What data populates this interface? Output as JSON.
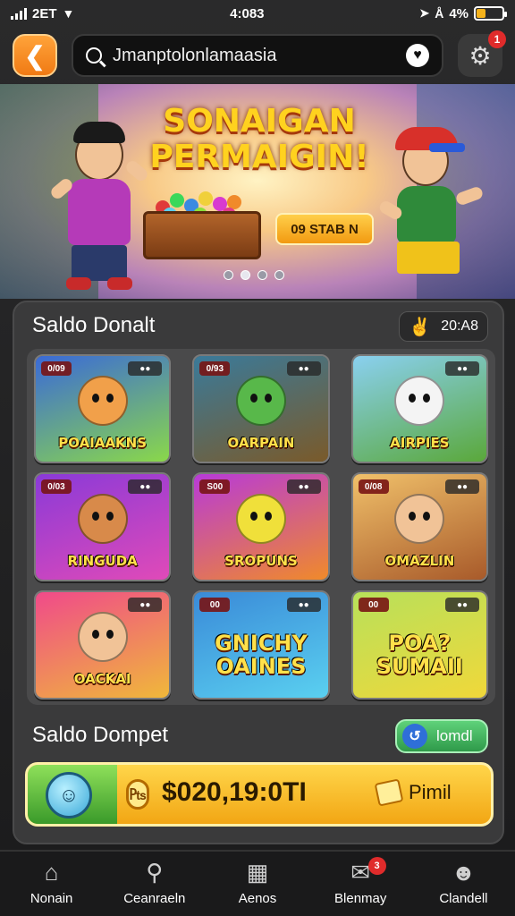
{
  "status_bar": {
    "carrier": "2ET",
    "time": "4:083",
    "battery_text": "4%",
    "battery_level": 0.35
  },
  "header": {
    "back_icon": "chevron-left-icon",
    "search_text": "Jmanptolonlamaasia",
    "notification_count": "1"
  },
  "banner": {
    "title": "SONAIGAN PERMAIGIN!",
    "cta_label": "09 STAB N",
    "slides_total": 4,
    "active_slide": 1
  },
  "games_section": {
    "title": "Saldo Donalt",
    "balance": "20:A8",
    "games": [
      {
        "title": "POAIAAKNS",
        "tag": "0/09",
        "tag2": "",
        "color1": "#3a6ad8",
        "color2": "#8ad84a",
        "mascot": "#f1a04a"
      },
      {
        "title": "OARPAIN",
        "tag": "0/93",
        "tag2": "",
        "color1": "#3a7a9a",
        "color2": "#7a5a2a",
        "mascot": "#58b84a"
      },
      {
        "title": "AIRPIES",
        "tag": "",
        "tag2": "",
        "color1": "#8ad0f0",
        "color2": "#5aa83a",
        "mascot": "#f4f4f4"
      },
      {
        "title": "RINGUDA",
        "tag": "0/03",
        "tag2": "",
        "color1": "#8a3ad8",
        "color2": "#e04ab8",
        "mascot": "#d88a4a"
      },
      {
        "title": "SROPUNS",
        "tag": "S00",
        "tag2": "",
        "color1": "#b83ad8",
        "color2": "#f08a2a",
        "mascot": "#f0e03a"
      },
      {
        "title": "OMAZLIN",
        "tag": "0/08",
        "tag2": "",
        "color1": "#f0c06a",
        "color2": "#a85a2a",
        "mascot": "#f1c397"
      },
      {
        "title": "OACKAI",
        "tag": "",
        "tag2": "",
        "color1": "#f04a8a",
        "color2": "#f0b83a",
        "mascot": "#f1c397"
      },
      {
        "title": "GNICHY OAINES",
        "tag": "00",
        "tag2": "",
        "color1": "#3a8ad8",
        "color2": "#5ad0f0",
        "mascot": ""
      },
      {
        "title": "POA? SUMAII",
        "tag": "00",
        "tag2": "",
        "color1": "#b8e05a",
        "color2": "#f0d83a",
        "mascot": ""
      }
    ]
  },
  "wallet": {
    "title": "Saldo Dompet",
    "topup_label": "lomdl",
    "amount": "$020,19:0TI",
    "action_label": "Pimil"
  },
  "bottom_nav": [
    {
      "label": "Nonain",
      "icon": "home-icon"
    },
    {
      "label": "Ceanraeln",
      "icon": "search-icon"
    },
    {
      "label": "Aenos",
      "icon": "box-icon"
    },
    {
      "label": "Blenmay",
      "icon": "mail-icon",
      "badge": "3"
    },
    {
      "label": "Clandell",
      "icon": "user-icon"
    }
  ]
}
